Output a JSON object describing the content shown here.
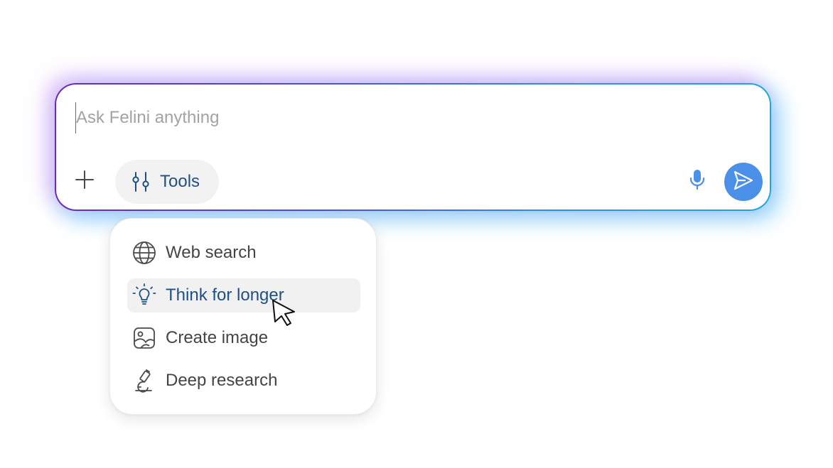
{
  "composer": {
    "placeholder": "Ask Felini anything",
    "value": "",
    "tools_label": "Tools",
    "icons": {
      "add": "plus-icon",
      "tools": "sliders-icon",
      "mic": "microphone-icon",
      "send": "send-icon"
    },
    "colors": {
      "border_gradient_start": "#6b2ab8",
      "border_gradient_end": "#1fa6d8",
      "send_button": "#4a90e8",
      "tools_text": "#1f4f86"
    }
  },
  "tools_menu": {
    "items": [
      {
        "label": "Web search",
        "icon": "globe-icon",
        "active": false
      },
      {
        "label": "Think for longer",
        "icon": "lightbulb-icon",
        "active": true
      },
      {
        "label": "Create image",
        "icon": "image-icon",
        "active": false
      },
      {
        "label": "Deep research",
        "icon": "microscope-icon",
        "active": false
      }
    ],
    "colors": {
      "active_background": "#f1f1f1",
      "active_text": "#1f4f86",
      "text": "#444444"
    }
  },
  "pointer": {
    "icon": "hand-pointer-icon"
  }
}
